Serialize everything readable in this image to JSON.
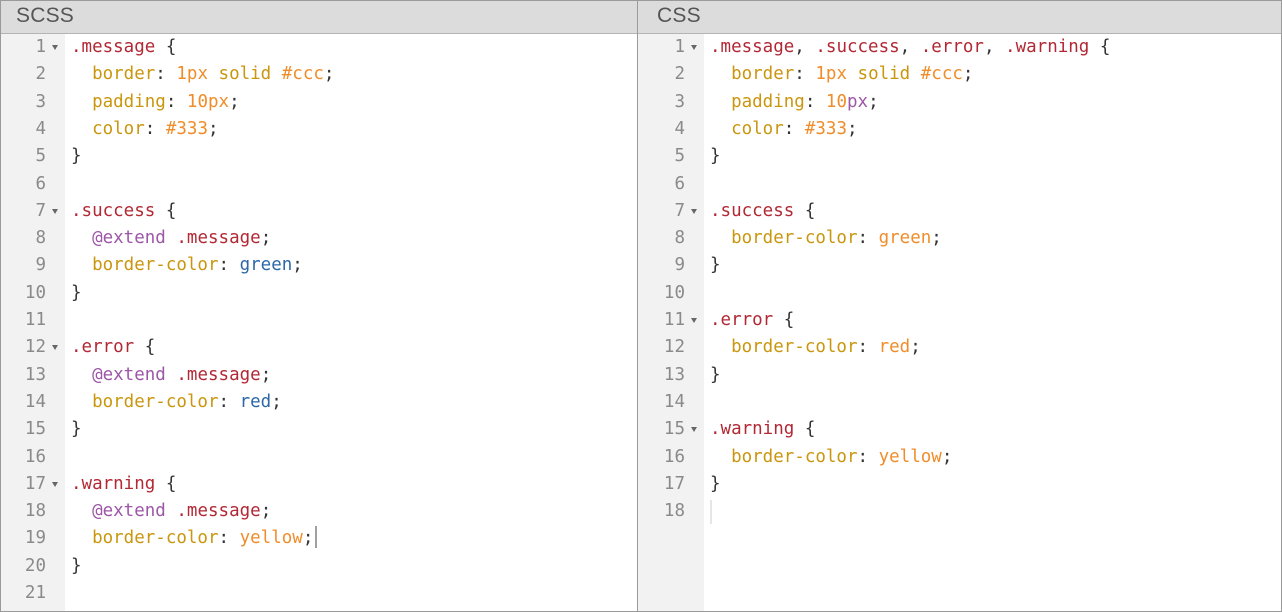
{
  "left_pane": {
    "title": "SCSS",
    "lines": [
      {
        "n": "1",
        "fold": true,
        "tokens": [
          {
            "t": ".message",
            "c": "selector"
          },
          {
            "t": " {",
            "c": "punct"
          }
        ]
      },
      {
        "n": "2",
        "fold": false,
        "tokens": [
          {
            "t": "  border",
            "c": "property"
          },
          {
            "t": ": ",
            "c": "punct"
          },
          {
            "t": "1px",
            "c": "number"
          },
          {
            "t": " ",
            "c": "punct"
          },
          {
            "t": "solid",
            "c": "keyword"
          },
          {
            "t": " ",
            "c": "punct"
          },
          {
            "t": "#ccc",
            "c": "hex"
          },
          {
            "t": ";",
            "c": "punct"
          }
        ]
      },
      {
        "n": "3",
        "fold": false,
        "tokens": [
          {
            "t": "  padding",
            "c": "property"
          },
          {
            "t": ": ",
            "c": "punct"
          },
          {
            "t": "10px",
            "c": "number"
          },
          {
            "t": ";",
            "c": "punct"
          }
        ]
      },
      {
        "n": "4",
        "fold": false,
        "tokens": [
          {
            "t": "  color",
            "c": "property"
          },
          {
            "t": ": ",
            "c": "punct"
          },
          {
            "t": "#333",
            "c": "hex"
          },
          {
            "t": ";",
            "c": "punct"
          }
        ]
      },
      {
        "n": "5",
        "fold": false,
        "tokens": [
          {
            "t": "}",
            "c": "punct"
          }
        ]
      },
      {
        "n": "6",
        "fold": false,
        "tokens": []
      },
      {
        "n": "7",
        "fold": true,
        "tokens": [
          {
            "t": ".success",
            "c": "selector"
          },
          {
            "t": " {",
            "c": "punct"
          }
        ]
      },
      {
        "n": "8",
        "fold": false,
        "tokens": [
          {
            "t": "  ",
            "c": "punct"
          },
          {
            "t": "@extend",
            "c": "atrule"
          },
          {
            "t": " ",
            "c": "punct"
          },
          {
            "t": ".message",
            "c": "selector"
          },
          {
            "t": ";",
            "c": "punct"
          }
        ]
      },
      {
        "n": "9",
        "fold": false,
        "tokens": [
          {
            "t": "  border-color",
            "c": "property"
          },
          {
            "t": ": ",
            "c": "punct"
          },
          {
            "t": "green",
            "c": "varname"
          },
          {
            "t": ";",
            "c": "punct"
          }
        ]
      },
      {
        "n": "10",
        "fold": false,
        "tokens": [
          {
            "t": "}",
            "c": "punct"
          }
        ]
      },
      {
        "n": "11",
        "fold": false,
        "tokens": []
      },
      {
        "n": "12",
        "fold": true,
        "tokens": [
          {
            "t": ".error",
            "c": "selector"
          },
          {
            "t": " {",
            "c": "punct"
          }
        ]
      },
      {
        "n": "13",
        "fold": false,
        "tokens": [
          {
            "t": "  ",
            "c": "punct"
          },
          {
            "t": "@extend",
            "c": "atrule"
          },
          {
            "t": " ",
            "c": "punct"
          },
          {
            "t": ".message",
            "c": "selector"
          },
          {
            "t": ";",
            "c": "punct"
          }
        ]
      },
      {
        "n": "14",
        "fold": false,
        "tokens": [
          {
            "t": "  border-color",
            "c": "property"
          },
          {
            "t": ": ",
            "c": "punct"
          },
          {
            "t": "red",
            "c": "varname"
          },
          {
            "t": ";",
            "c": "punct"
          }
        ]
      },
      {
        "n": "15",
        "fold": false,
        "tokens": [
          {
            "t": "}",
            "c": "punct"
          }
        ]
      },
      {
        "n": "16",
        "fold": false,
        "tokens": []
      },
      {
        "n": "17",
        "fold": true,
        "tokens": [
          {
            "t": ".warning",
            "c": "selector"
          },
          {
            "t": " {",
            "c": "punct"
          }
        ]
      },
      {
        "n": "18",
        "fold": false,
        "tokens": [
          {
            "t": "  ",
            "c": "punct"
          },
          {
            "t": "@extend",
            "c": "atrule"
          },
          {
            "t": " ",
            "c": "punct"
          },
          {
            "t": ".message",
            "c": "selector"
          },
          {
            "t": ";",
            "c": "punct"
          }
        ]
      },
      {
        "n": "19",
        "fold": false,
        "cursor": true,
        "tokens": [
          {
            "t": "  border-color",
            "c": "property"
          },
          {
            "t": ": ",
            "c": "punct"
          },
          {
            "t": "yellow",
            "c": "value"
          },
          {
            "t": ";",
            "c": "punct"
          }
        ]
      },
      {
        "n": "20",
        "fold": false,
        "tokens": [
          {
            "t": "}",
            "c": "punct"
          }
        ]
      },
      {
        "n": "21",
        "fold": false,
        "tokens": []
      }
    ]
  },
  "right_pane": {
    "title": "CSS",
    "lines": [
      {
        "n": "1",
        "fold": true,
        "tokens": [
          {
            "t": ".message",
            "c": "selector"
          },
          {
            "t": ", ",
            "c": "punct"
          },
          {
            "t": ".success",
            "c": "selector"
          },
          {
            "t": ", ",
            "c": "punct"
          },
          {
            "t": ".error",
            "c": "selector"
          },
          {
            "t": ", ",
            "c": "punct"
          },
          {
            "t": ".warning",
            "c": "selector"
          },
          {
            "t": " {",
            "c": "punct"
          }
        ]
      },
      {
        "n": "2",
        "fold": false,
        "tokens": [
          {
            "t": "  border",
            "c": "property"
          },
          {
            "t": ": ",
            "c": "punct"
          },
          {
            "t": "1px",
            "c": "number"
          },
          {
            "t": " ",
            "c": "punct"
          },
          {
            "t": "solid",
            "c": "keyword"
          },
          {
            "t": " ",
            "c": "punct"
          },
          {
            "t": "#ccc",
            "c": "hex"
          },
          {
            "t": ";",
            "c": "punct"
          }
        ]
      },
      {
        "n": "3",
        "fold": false,
        "tokens": [
          {
            "t": "  padding",
            "c": "property"
          },
          {
            "t": ": ",
            "c": "punct"
          },
          {
            "t": "10",
            "c": "number"
          },
          {
            "t": "px",
            "c": "unit"
          },
          {
            "t": ";",
            "c": "punct"
          }
        ]
      },
      {
        "n": "4",
        "fold": false,
        "tokens": [
          {
            "t": "  color",
            "c": "property"
          },
          {
            "t": ": ",
            "c": "punct"
          },
          {
            "t": "#333",
            "c": "hex"
          },
          {
            "t": ";",
            "c": "punct"
          }
        ]
      },
      {
        "n": "5",
        "fold": false,
        "tokens": [
          {
            "t": "}",
            "c": "punct"
          }
        ]
      },
      {
        "n": "6",
        "fold": false,
        "tokens": []
      },
      {
        "n": "7",
        "fold": true,
        "tokens": [
          {
            "t": ".success",
            "c": "selector"
          },
          {
            "t": " {",
            "c": "punct"
          }
        ]
      },
      {
        "n": "8",
        "fold": false,
        "tokens": [
          {
            "t": "  border-color",
            "c": "property"
          },
          {
            "t": ": ",
            "c": "punct"
          },
          {
            "t": "green",
            "c": "value"
          },
          {
            "t": ";",
            "c": "punct"
          }
        ]
      },
      {
        "n": "9",
        "fold": false,
        "tokens": [
          {
            "t": "}",
            "c": "punct"
          }
        ]
      },
      {
        "n": "10",
        "fold": false,
        "tokens": []
      },
      {
        "n": "11",
        "fold": true,
        "tokens": [
          {
            "t": ".error",
            "c": "selector"
          },
          {
            "t": " {",
            "c": "punct"
          }
        ]
      },
      {
        "n": "12",
        "fold": false,
        "tokens": [
          {
            "t": "  border-color",
            "c": "property"
          },
          {
            "t": ": ",
            "c": "punct"
          },
          {
            "t": "red",
            "c": "value"
          },
          {
            "t": ";",
            "c": "punct"
          }
        ]
      },
      {
        "n": "13",
        "fold": false,
        "tokens": [
          {
            "t": "}",
            "c": "punct"
          }
        ]
      },
      {
        "n": "14",
        "fold": false,
        "tokens": []
      },
      {
        "n": "15",
        "fold": true,
        "tokens": [
          {
            "t": ".warning",
            "c": "selector"
          },
          {
            "t": " {",
            "c": "punct"
          }
        ]
      },
      {
        "n": "16",
        "fold": false,
        "tokens": [
          {
            "t": "  border-color",
            "c": "property"
          },
          {
            "t": ": ",
            "c": "punct"
          },
          {
            "t": "yellow",
            "c": "value"
          },
          {
            "t": ";",
            "c": "punct"
          }
        ]
      },
      {
        "n": "17",
        "fold": false,
        "tokens": [
          {
            "t": "}",
            "c": "punct"
          }
        ]
      },
      {
        "n": "18",
        "fold": false,
        "ghost_cursor": true,
        "tokens": []
      }
    ]
  },
  "colors": {
    "selector": "#b22834",
    "property": "#c9960d",
    "number": "#f08d2a",
    "keyword": "#c9960d",
    "atrule": "#9d56a8",
    "value_scss_identifier": "#2c68a8",
    "value_css": "#f08d2a",
    "unit": "#9d56a8",
    "punctuation": "#333333",
    "line_number": "#8a8a8a",
    "gutter_bg": "#f2f2f2",
    "header_bg": "#dcdcdc"
  },
  "icons": {
    "fold": "fold-triangle-icon",
    "cursor": "text-cursor"
  }
}
